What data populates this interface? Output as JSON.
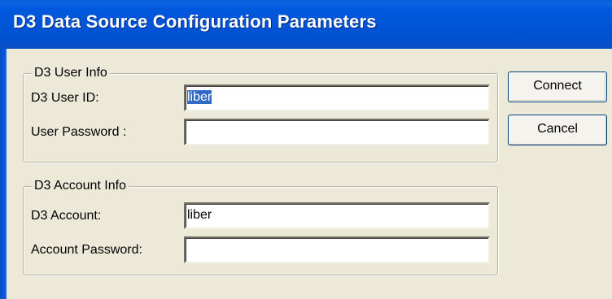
{
  "window": {
    "title": "D3 Data Source Configuration Parameters"
  },
  "user_info": {
    "legend": "D3 User Info",
    "user_id_label": "D3 User ID:",
    "user_id_value": "liber",
    "password_label": "User Password :",
    "password_value": ""
  },
  "account_info": {
    "legend": "D3 Account Info",
    "account_label": "D3 Account:",
    "account_value": "liber",
    "password_label": "Account Password:",
    "password_value": ""
  },
  "buttons": {
    "connect_label": "Connect",
    "cancel_label": "Cancel"
  },
  "colors": {
    "titlebar": "#0054d6",
    "selection": "#316ac5",
    "dialog_background": "#ece9d8"
  }
}
